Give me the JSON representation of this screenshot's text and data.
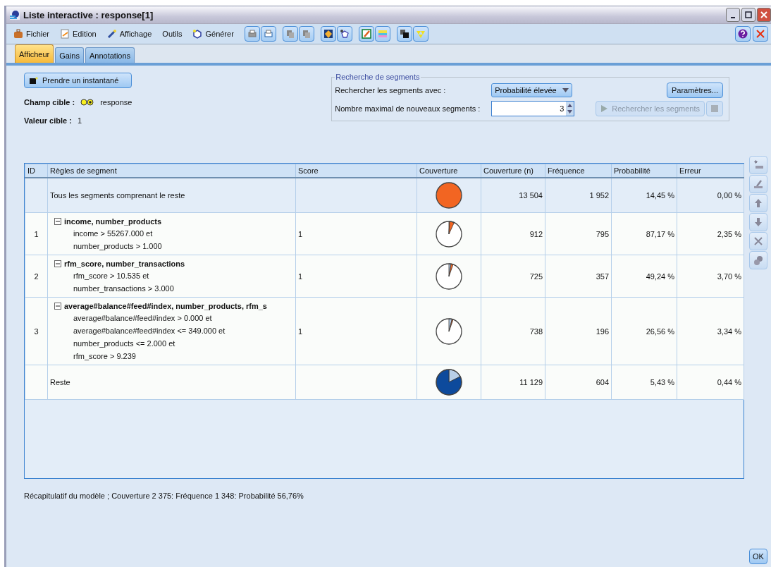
{
  "window": {
    "title": "Liste interactive : response[1]"
  },
  "menu": [
    "Fichier",
    "Edition",
    "Affichage",
    "Outils",
    "Générer"
  ],
  "tabs": [
    {
      "label": "Afficheur",
      "selected": true
    },
    {
      "label": "Gains",
      "selected": false
    },
    {
      "label": "Annotations",
      "selected": false
    }
  ],
  "snapshot_button": "Prendre un instantané",
  "target_field": {
    "label": "Champ cible :",
    "value": "response"
  },
  "target_value": {
    "label": "Valeur cible :",
    "value": "1"
  },
  "segment_search": {
    "title": "Recherche de segments",
    "search_label": "Rechercher les segments avec :",
    "search_value": "Probabilité élevée",
    "max_label": "Nombre maximal de nouveaux segments :",
    "max_value": "3",
    "settings_button": "Paramètres...",
    "search_button": {
      "label": "Rechercher les segments",
      "disabled": true
    },
    "stop_disabled": true
  },
  "table": {
    "columns": [
      "ID",
      "Règles de segment",
      "Score",
      "Couverture",
      "Couverture (n)",
      "Fréquence",
      "Probabilité",
      "Erreur"
    ],
    "rows": [
      {
        "kind": "total",
        "id": "",
        "title": "Tous les segments comprenant le reste",
        "score": "",
        "coverage_n": "13 504",
        "frequency": "1 952",
        "probability": "14,45 %",
        "error": "0,00 %"
      },
      {
        "kind": "segment",
        "id": "1",
        "title": "income, number_products",
        "expanded": true,
        "conditions": [
          "income > 55267.000 et",
          "number_products > 1.000"
        ],
        "score": "1",
        "coverage_n": "912",
        "frequency": "795",
        "probability": "87,17 %",
        "error": "2,35 %"
      },
      {
        "kind": "segment",
        "id": "2",
        "title": "rfm_score, number_transactions",
        "expanded": true,
        "conditions": [
          "rfm_score > 10.535 et",
          "number_transactions > 3.000"
        ],
        "score": "1",
        "coverage_n": "725",
        "frequency": "357",
        "probability": "49,24 %",
        "error": "3,70 %"
      },
      {
        "kind": "segment",
        "id": "3",
        "title": "average#balance#feed#index, number_products, rfm_s",
        "expanded": true,
        "conditions": [
          "average#balance#feed#index > 0.000 et",
          "average#balance#feed#index <= 349.000 et",
          "number_products <= 2.000 et",
          "rfm_score > 9.239"
        ],
        "score": "1",
        "coverage_n": "738",
        "frequency": "196",
        "probability": "26,56 %",
        "error": "3,34 %"
      },
      {
        "kind": "rest",
        "id": "",
        "title": "Reste",
        "score": "",
        "coverage_n": "11 129",
        "frequency": "604",
        "probability": "5,43 %",
        "error": "0,44 %"
      }
    ]
  },
  "summary": "Récapitulatif du modèle ; Couverture 2 375: Fréquence 1 348: Probabilité 56,76%",
  "ok_button": "OK"
}
